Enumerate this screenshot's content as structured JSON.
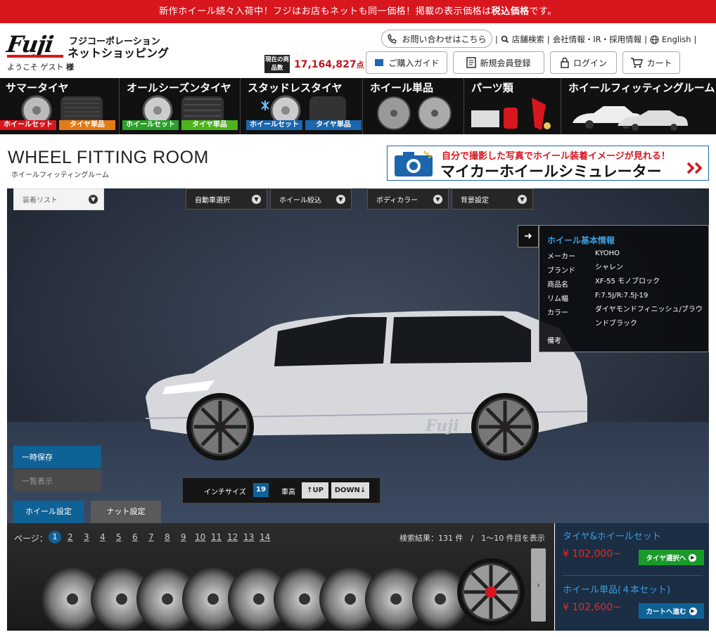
{
  "announcement": {
    "prefix": "新作ホイール続々入荷中！フジはお店もネットも同一価格！掲載の表示価格は",
    "bold": "税込価格",
    "suffix": "です。"
  },
  "logo": {
    "text": "Fuji",
    "corp_line1": "フジコーポレーション",
    "corp_line2": "ネットショッピング"
  },
  "welcome": {
    "prefix": "ようこそ ゲスト ",
    "suffix": "様"
  },
  "header": {
    "contact_label": "お問い合わせはこちら",
    "links": [
      "店舗検索",
      "会社情報・IR・採用情報",
      "English"
    ],
    "guide_label": "ご購入ガイド",
    "register_label": "新規会員登録",
    "login_label": "ログイン",
    "cart_label": "カート",
    "count_badge": "現在の商品数",
    "count_value": "17,164,827",
    "count_unit": "点"
  },
  "categories": [
    {
      "title": "サマータイヤ",
      "tags": [
        "ホイールセット",
        "タイヤ単品"
      ]
    },
    {
      "title": "オールシーズンタイヤ",
      "tags": [
        "ホイールセット",
        "タイヤ単品"
      ]
    },
    {
      "title": "スタッドレスタイヤ",
      "tags": [
        "ホイールセット",
        "タイヤ単品"
      ]
    },
    {
      "title": "ホイール単品",
      "tags": []
    },
    {
      "title": "パーツ類",
      "tags": []
    },
    {
      "title": "ホイールフィッティングルーム",
      "tags": []
    }
  ],
  "page_title": {
    "main": "WHEEL FITTING ROOM",
    "sub": "ホイールフィッティングルーム"
  },
  "simulator": {
    "line1": "自分で撮影した写真でホイール装着イメージが見れる！",
    "line2": "マイカーホイールシミュレーター"
  },
  "dropdowns": {
    "list": "装着リスト",
    "car": "自動車選択",
    "wheel": "ホイール絞込",
    "body": "ボディカラー",
    "bg": "背景設定"
  },
  "info": {
    "title": "ホイール基本情報",
    "rows": [
      {
        "k": "メーカー",
        "v": "KYOHO"
      },
      {
        "k": "ブランド",
        "v": "シャレン"
      },
      {
        "k": "商品名",
        "v": "XF-55 モノブロック"
      },
      {
        "k": "リム幅",
        "v": "F:7.5J/R:7.5J-19"
      },
      {
        "k": "カラー",
        "v": "ダイヤモンドフィニッシュ/ブラウンドブラック"
      },
      {
        "k": "備考",
        "v": ""
      }
    ]
  },
  "buttons": {
    "save": "一時保存",
    "list": "一覧表示"
  },
  "controls": {
    "inch_label": "インチサイズ",
    "inch_value": "19",
    "height_label": "車高",
    "up": "UP",
    "down": "DOWN"
  },
  "tabs": {
    "wheel": "ホイール設定",
    "nut": "ナット設定"
  },
  "pagination": {
    "label": "ページ：",
    "pages": [
      "1",
      "2",
      "3",
      "4",
      "5",
      "6",
      "7",
      "8",
      "9",
      "10",
      "11",
      "12",
      "13",
      "14"
    ],
    "results": "検索結果：131 件　/　1〜10 件目を表示"
  },
  "pricing": {
    "set_title": "タイヤ&ホイールセット",
    "set_price": "¥ 102,000~",
    "set_btn": "タイヤ選択へ",
    "single_title": "ホイール単品(４本セット)",
    "single_price": "¥ 102,600~",
    "cart_btn": "カートへ進む"
  },
  "colors": {
    "accent_red": "#d8161e",
    "accent_blue": "#0f6296",
    "green": "#1a9a2a"
  },
  "car_watermark": "Fuji"
}
